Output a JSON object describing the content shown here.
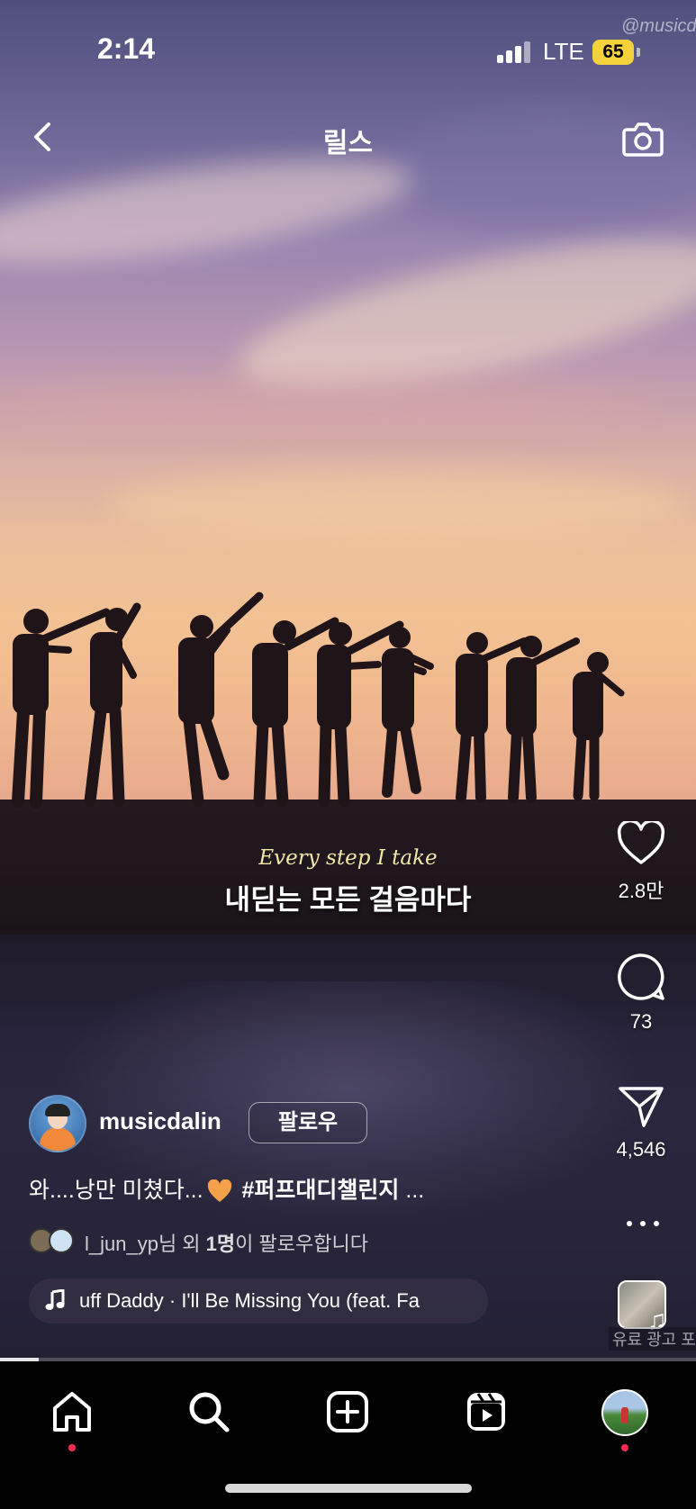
{
  "status_bar": {
    "time": "2:14",
    "network": "LTE",
    "battery": "65",
    "watermark": "@musicda"
  },
  "header": {
    "title": "릴스"
  },
  "video": {
    "subtitle_en": "Every step I take",
    "subtitle_ko": "내딛는 모든 걸음마다",
    "progress": 0.055
  },
  "actions": {
    "likes": "2.8만",
    "comments": "73",
    "shares": "4,546"
  },
  "ad_label": "유료 광고 포",
  "author": {
    "username": "musicdalin",
    "follow_label": "팔로우"
  },
  "caption": {
    "text": "와....낭만 미쳤다...",
    "hashtag": "#퍼프대디챌린지",
    "more": "..."
  },
  "followers": {
    "name": "l_jun_yp",
    "suffix": "님 외 ",
    "count": "1명",
    "tail": "이 팔로우합니다"
  },
  "music": {
    "track": "uff Daddy · I'll Be Missing You (feat. Fa"
  },
  "icons": {
    "back": "chevron-left-icon",
    "camera": "camera-icon",
    "like": "heart-icon",
    "comment": "comment-bubble-icon",
    "share": "paper-plane-icon",
    "more": "more-dots-icon",
    "music": "music-note-icon",
    "home": "home-icon",
    "search": "search-icon",
    "create": "plus-square-icon",
    "reels": "reels-icon"
  },
  "colors": {
    "notification_dot": "#ff2d55",
    "battery": "#f4d23c",
    "subtitle_en": "#f3e6a8"
  }
}
